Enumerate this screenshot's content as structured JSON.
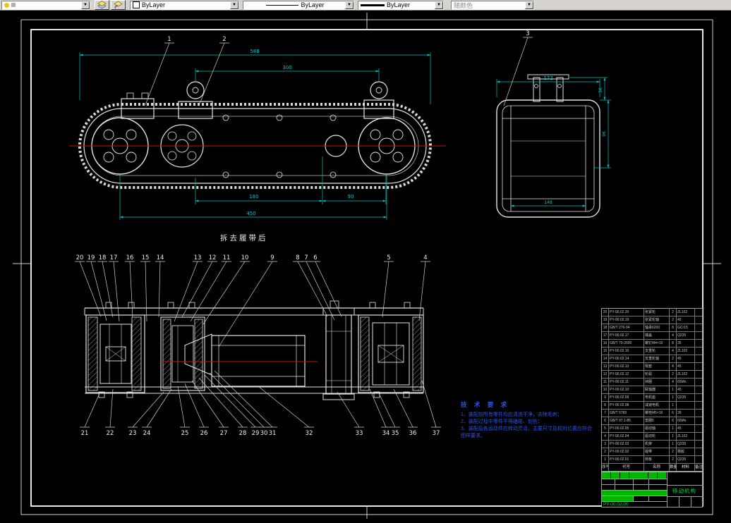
{
  "toolbar": {
    "color_value": "ByLayer",
    "linetype_value": "ByLayer",
    "lineweight_value": "ByLayer",
    "plotstyle_value": "随颜色"
  },
  "drawing": {
    "note": "拆去履带后",
    "top_view": {
      "labels": [
        "1",
        "2"
      ],
      "dims": [
        "588",
        "300",
        "180",
        "90",
        "450"
      ]
    },
    "side_view": {
      "label": "3",
      "dims": [
        "172",
        "36",
        "96",
        "148"
      ]
    },
    "section": {
      "top_labels": [
        "20",
        "19",
        "18",
        "17",
        "16",
        "15",
        "14",
        "13",
        "12",
        "11",
        "10",
        "9",
        "8",
        "7",
        "6",
        "5",
        "4"
      ],
      "bottom_labels": [
        "21",
        "22",
        "23",
        "24",
        "25",
        "26",
        "27",
        "28",
        "29",
        "30",
        "31",
        "32",
        "33",
        "34",
        "35",
        "36",
        "37"
      ]
    },
    "tech_requirements": {
      "title": "技 术 要 求",
      "items": [
        "1、装配前所有零件均应清洗干净，去除毛刺；",
        "2、装配过程中零件不得磕碰、划伤；",
        "3、装配后各运动件应转动灵活，主要尺寸及相对位置应符合图样要求。"
      ]
    }
  },
  "bom": {
    "headers": [
      "序号",
      "代号",
      "名称",
      "数量",
      "材料",
      "备注"
    ],
    "rows": [
      {
        "seq": "20",
        "code": "PY-00.02.20",
        "name": "张紧轮",
        "qty": "2",
        "mat": "ZL102",
        "rem": ""
      },
      {
        "seq": "19",
        "code": "PY-00.02.19",
        "name": "张紧轮轴",
        "qty": "2",
        "mat": "45",
        "rem": ""
      },
      {
        "seq": "18",
        "code": "GB/T 276-94",
        "name": "轴承6200",
        "qty": "8",
        "mat": "GCr15",
        "rem": ""
      },
      {
        "seq": "17",
        "code": "PY-00.02.17",
        "name": "端盖",
        "qty": "4",
        "mat": "Q235",
        "rem": ""
      },
      {
        "seq": "16",
        "code": "GB/T 70-2000",
        "name": "螺钉M4×10",
        "qty": "8",
        "mat": "35",
        "rem": ""
      },
      {
        "seq": "15",
        "code": "PY-00.02.15",
        "name": "支重轮",
        "qty": "4",
        "mat": "ZL102",
        "rem": ""
      },
      {
        "seq": "14",
        "code": "PY-00.02.14",
        "name": "支重轮轴",
        "qty": "2",
        "mat": "45",
        "rem": ""
      },
      {
        "seq": "13",
        "code": "PY-00.02.13",
        "name": "隔套",
        "qty": "4",
        "mat": "45",
        "rem": ""
      },
      {
        "seq": "12",
        "code": "PY-00.02.12",
        "name": "轮毂",
        "qty": "2",
        "mat": "ZL102",
        "rem": ""
      },
      {
        "seq": "11",
        "code": "PY-00.02.11",
        "name": "挡圈",
        "qty": "4",
        "mat": "65Mn",
        "rem": ""
      },
      {
        "seq": "10",
        "code": "PY-00.02.10",
        "name": "联轴器",
        "qty": "1",
        "mat": "45",
        "rem": ""
      },
      {
        "seq": "9",
        "code": "PY-00.02.09",
        "name": "电机座",
        "qty": "1",
        "mat": "Q235",
        "rem": ""
      },
      {
        "seq": "8",
        "code": "PY-00.02.08",
        "name": "减速电机",
        "qty": "1",
        "mat": "",
        "rem": ""
      },
      {
        "seq": "7",
        "code": "GB/T 5783",
        "name": "螺栓M5×16",
        "qty": "6",
        "mat": "35",
        "rem": ""
      },
      {
        "seq": "6",
        "code": "GB/T 97.1-85",
        "name": "垫圈5",
        "qty": "6",
        "mat": "65Mn",
        "rem": ""
      },
      {
        "seq": "5",
        "code": "PY-00.02.05",
        "name": "驱动轴",
        "qty": "1",
        "mat": "45",
        "rem": ""
      },
      {
        "seq": "4",
        "code": "PY-00.02.04",
        "name": "驱动轮",
        "qty": "1",
        "mat": "ZL102",
        "rem": ""
      },
      {
        "seq": "3",
        "code": "PY-00.02.03",
        "name": "机架",
        "qty": "1",
        "mat": "Q235",
        "rem": ""
      },
      {
        "seq": "2",
        "code": "PY-00.02.02",
        "name": "履带",
        "qty": "2",
        "mat": "橡胶",
        "rem": ""
      },
      {
        "seq": "1",
        "code": "PY-00.02.01",
        "name": "侧板",
        "qty": "2",
        "mat": "Q235",
        "rem": ""
      }
    ]
  },
  "title_block": {
    "part_name": "移动机构",
    "drawing_no": "PY-00.02.00"
  }
}
